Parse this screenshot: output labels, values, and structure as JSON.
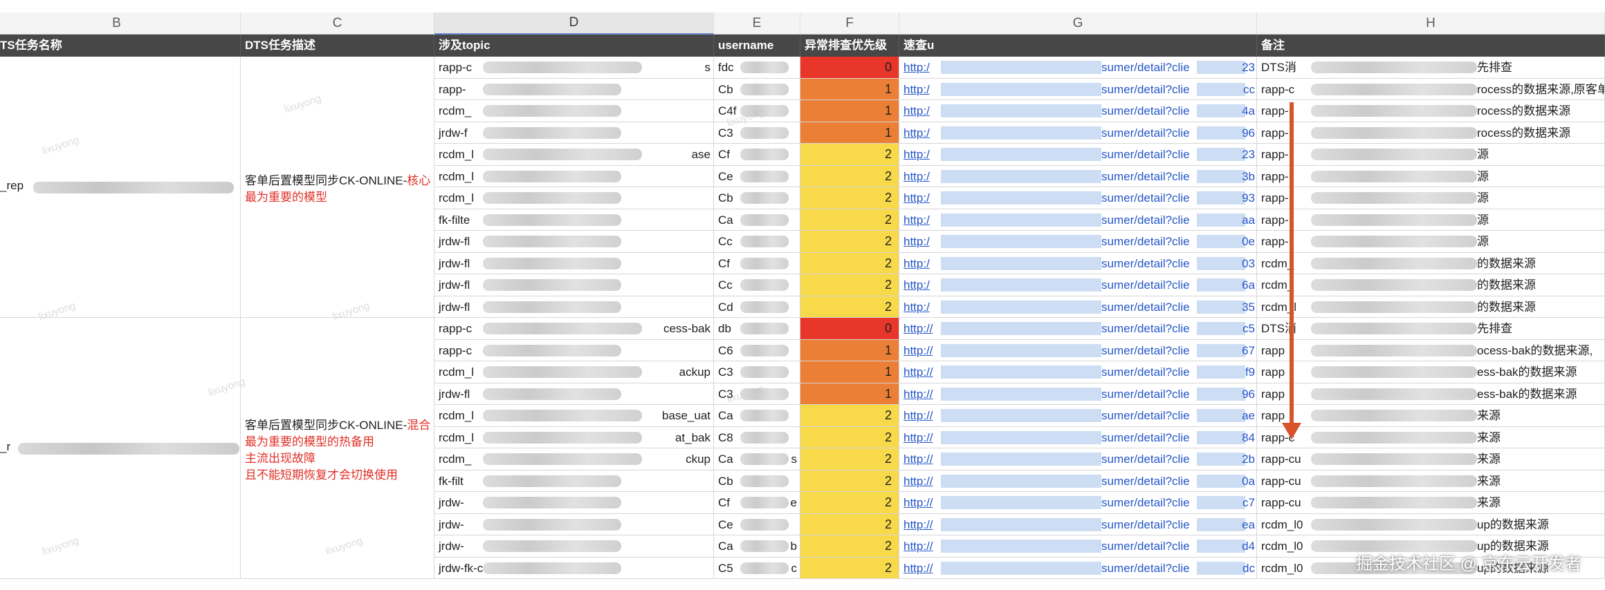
{
  "column_letters": [
    "B",
    "C",
    "D",
    "E",
    "F",
    "G",
    "H"
  ],
  "headers": [
    "TS任务名称",
    "DTS任务描述",
    "涉及topic",
    "username",
    "异常排查优先级",
    "速查u",
    "备注"
  ],
  "colors": {
    "p0": "#e8362a",
    "p1": "#ea7f35",
    "p2": "#f7d94a",
    "header_bg": "#474747",
    "link": "#2456c8",
    "red_text": "#e03028",
    "arrow": "#d8522c"
  },
  "groups": [
    {
      "name": "_rep",
      "desc_lines": [
        {
          "text": "客单后置模型同步CK-ONLINE-",
          "red": "核心"
        },
        {
          "text": "最为重要的模型",
          "red": ""
        }
      ]
    },
    {
      "name": "_r",
      "desc_lines": [
        {
          "text": "客单后置模型同步CK-ONLINE-",
          "red": "混合"
        },
        {
          "text": "最为重要的模型的热备用",
          "red": ""
        },
        {
          "text": "主流出现故障",
          "red": ""
        },
        {
          "text": "且不能短期恢复才会切换使用",
          "red": ""
        }
      ]
    }
  ],
  "rows": [
    {
      "topic_a": "rapp-c",
      "topic_b": "s",
      "user_a": "fdc",
      "user_b": "",
      "priority": "0",
      "link_a": "http:/",
      "link_b": "sumer/detail?clie",
      "link_c": "23",
      "note_a": "DTS消",
      "note_b": "先排查"
    },
    {
      "topic_a": "rapp-",
      "topic_b": "",
      "user_a": "Cb",
      "user_b": "",
      "priority": "1",
      "link_a": "http:/",
      "link_b": "sumer/detail?clie",
      "link_c": "cc",
      "note_a": "rapp-c",
      "note_b": "rocess的数据来源,原客单"
    },
    {
      "topic_a": "rcdm_",
      "topic_b": "",
      "user_a": "C4f",
      "user_b": "",
      "priority": "1",
      "link_a": "http:/",
      "link_b": "sumer/detail?clie",
      "link_c": "4a",
      "note_a": "rapp-",
      "note_b": "rocess的数据来源"
    },
    {
      "topic_a": "jrdw-f",
      "topic_b": "",
      "user_a": "C3",
      "user_b": "",
      "priority": "1",
      "link_a": "http:/",
      "link_b": "sumer/detail?clie",
      "link_c": "96",
      "note_a": "rapp-",
      "note_b": "rocess的数据来源"
    },
    {
      "topic_a": "rcdm_l",
      "topic_b": "ase",
      "user_a": "Cf",
      "user_b": "",
      "priority": "2",
      "link_a": "http:/",
      "link_b": "sumer/detail?clie",
      "link_c": "23",
      "note_a": "rapp-",
      "note_b": "源"
    },
    {
      "topic_a": "rcdm_l",
      "topic_b": "",
      "user_a": "Ce",
      "user_b": "",
      "priority": "2",
      "link_a": "http:/",
      "link_b": "sumer/detail?clie",
      "link_c": "3b",
      "note_a": "rapp-",
      "note_b": "源"
    },
    {
      "topic_a": "rcdm_l",
      "topic_b": "",
      "user_a": "Cb",
      "user_b": "",
      "priority": "2",
      "link_a": "http:/",
      "link_b": "sumer/detail?clie",
      "link_c": "93",
      "note_a": "rapp-",
      "note_b": "源"
    },
    {
      "topic_a": "fk-filte",
      "topic_b": "",
      "user_a": "Ca",
      "user_b": "",
      "priority": "2",
      "link_a": "http:/",
      "link_b": "sumer/detail?clie",
      "link_c": "aa",
      "note_a": "rapp-",
      "note_b": "源"
    },
    {
      "topic_a": "jrdw-fl",
      "topic_b": "",
      "user_a": "Cc",
      "user_b": "",
      "priority": "2",
      "link_a": "http:/",
      "link_b": "sumer/detail?clie",
      "link_c": "0e",
      "note_a": "rapp-",
      "note_b": "源"
    },
    {
      "topic_a": "jrdw-fl",
      "topic_b": "",
      "user_a": "Cf",
      "user_b": "",
      "priority": "2",
      "link_a": "http:/",
      "link_b": "sumer/detail?clie",
      "link_c": "03",
      "note_a": "rcdm_",
      "note_b": "的数据来源"
    },
    {
      "topic_a": "jrdw-fl",
      "topic_b": "",
      "user_a": "Cc",
      "user_b": "",
      "priority": "2",
      "link_a": "http:/",
      "link_b": "sumer/detail?clie",
      "link_c": "6a",
      "note_a": "rcdm_",
      "note_b": "的数据来源"
    },
    {
      "topic_a": "jrdw-fl",
      "topic_b": "",
      "user_a": "Cd",
      "user_b": "",
      "priority": "2",
      "link_a": "http:/",
      "link_b": "sumer/detail?clie",
      "link_c": "35",
      "note_a": "rcdm_l",
      "note_b": "的数据来源"
    },
    {
      "topic_a": "rapp-c",
      "topic_b": "cess-bak",
      "user_a": "db",
      "user_b": "",
      "priority": "0",
      "link_a": "http://",
      "link_b": "sumer/detail?clie",
      "link_c": "c5",
      "note_a": "DTS消",
      "note_b": "先排查"
    },
    {
      "topic_a": "rapp-c",
      "topic_b": "",
      "user_a": "C6",
      "user_b": "",
      "priority": "1",
      "link_a": "http://",
      "link_b": "sumer/detail?clie",
      "link_c": "67",
      "note_a": "rapp",
      "note_b": "ocess-bak的数据来源,"
    },
    {
      "topic_a": "rcdm_l",
      "topic_b": "ackup",
      "user_a": "C3",
      "user_b": "",
      "priority": "1",
      "link_a": "http://",
      "link_b": "sumer/detail?clie",
      "link_c": "f9",
      "note_a": "rapp",
      "note_b": "ess-bak的数据来源"
    },
    {
      "topic_a": "jrdw-fl",
      "topic_b": "",
      "user_a": "C3",
      "user_b": "",
      "priority": "1",
      "link_a": "http://",
      "link_b": "sumer/detail?clie",
      "link_c": "96",
      "note_a": "rapp",
      "note_b": "ess-bak的数据来源"
    },
    {
      "topic_a": "rcdm_l",
      "topic_b": "base_uat",
      "user_a": "Ca",
      "user_b": "",
      "priority": "2",
      "link_a": "http://",
      "link_b": "sumer/detail?clie",
      "link_c": "ae",
      "note_a": "rapp",
      "note_b": "来源"
    },
    {
      "topic_a": "rcdm_l",
      "topic_b": "at_bak",
      "user_a": "C8",
      "user_b": "",
      "priority": "2",
      "link_a": "http://",
      "link_b": "sumer/detail?clie",
      "link_c": "84",
      "note_a": "rapp-c",
      "note_b": "来源"
    },
    {
      "topic_a": "rcdm_",
      "topic_b": "ckup",
      "user_a": "Ca",
      "user_b": "s",
      "priority": "2",
      "link_a": "http://",
      "link_b": "sumer/detail?clie",
      "link_c": "2b",
      "note_a": "rapp-cu",
      "note_b": "来源"
    },
    {
      "topic_a": "fk-filt",
      "topic_b": "",
      "user_a": "Cb",
      "user_b": "",
      "priority": "2",
      "link_a": "http://",
      "link_b": "sumer/detail?clie",
      "link_c": "0a",
      "note_a": "rapp-cu",
      "note_b": "来源"
    },
    {
      "topic_a": "jrdw-",
      "topic_b": "",
      "user_a": "Cf",
      "user_b": "e",
      "priority": "2",
      "link_a": "http://",
      "link_b": "sumer/detail?clie",
      "link_c": "c7",
      "note_a": "rapp-cu",
      "note_b": "来源"
    },
    {
      "topic_a": "jrdw-",
      "topic_b": "",
      "user_a": "Ce",
      "user_b": "",
      "priority": "2",
      "link_a": "http://",
      "link_b": "sumer/detail?clie",
      "link_c": "ea",
      "note_a": "rcdm_l0",
      "note_b": "up的数据来源"
    },
    {
      "topic_a": "jrdw-",
      "topic_b": "",
      "user_a": "Ca",
      "user_b": "b",
      "priority": "2",
      "link_a": "http://",
      "link_b": "sumer/detail?clie",
      "link_c": "d4",
      "note_a": "rcdm_l0",
      "note_b": "up的数据来源"
    },
    {
      "topic_a": "jrdw-fk-c",
      "topic_b": "",
      "user_a": "C5",
      "user_b": "c",
      "priority": "2",
      "link_a": "http://",
      "link_b": "sumer/detail?clie",
      "link_c": "dc",
      "note_a": "rcdm_l0",
      "note_b": "up的数据来源"
    }
  ],
  "watermark_text": "lixuyong",
  "bottom_watermark": "掘金技术社区 @ 京东云开发者"
}
